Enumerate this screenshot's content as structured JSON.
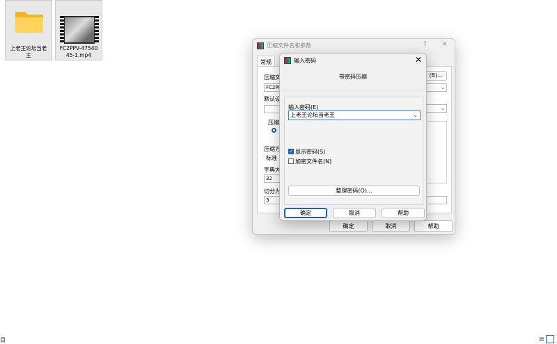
{
  "desktop": {
    "items": [
      {
        "label": "上老王论坛当老王",
        "type": "folder"
      },
      {
        "label": "FC2PPV-4754045-1.mp4",
        "type": "video"
      }
    ]
  },
  "back_dialog": {
    "title": "压缩文件名和参数",
    "help": "?",
    "close": "✕",
    "tab": "常规",
    "labels": {
      "archive_name": "压缩文",
      "default_settings": "默认设",
      "archive_format": "压缩文",
      "method": "压缩方",
      "dictionary": "字典大",
      "split": "切分为"
    },
    "values": {
      "archive_name": "FC2PP",
      "method": "标准",
      "dictionary": "32",
      "split": "3"
    },
    "browse_button": "(B)...",
    "ok_button": "确定",
    "cancel_button": "取消",
    "help_button": "帮助"
  },
  "password_dialog": {
    "title": "输入密码",
    "close": "✕",
    "subtitle": "带密码压缩",
    "password_label": "输入密码(E)",
    "password_value": "上老王论坛当老王",
    "show_password_label": "显示密码(S)",
    "show_password_checked": true,
    "encrypt_names_label": "加密文件名(N)",
    "encrypt_names_checked": false,
    "organize_button": "整理密码(O)...",
    "ok_button": "确定",
    "cancel_button": "取消",
    "help_button": "帮助"
  },
  "taskbar": {
    "left_text": "目",
    "right_icon": "≡"
  }
}
